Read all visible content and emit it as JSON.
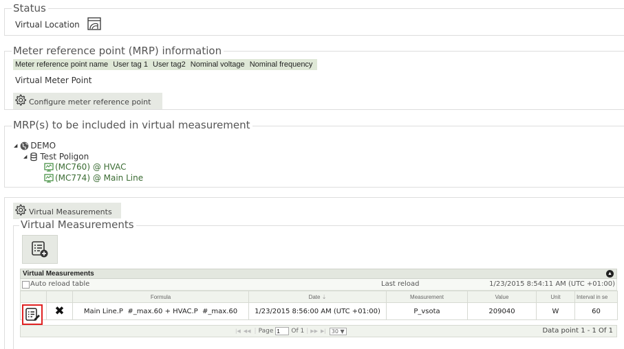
{
  "status": {
    "legend": "Status",
    "location_label": "Virtual Location"
  },
  "mrp": {
    "legend": "Meter reference point (MRP) information",
    "columns": [
      "Meter reference point name",
      "User tag 1",
      "User tag2",
      "Nominal voltage",
      "Nominal frequency"
    ],
    "value": "Virtual Meter Point",
    "configure_label": "Configure meter reference point"
  },
  "included": {
    "legend": "MRP(s) to be included in virtual measurement",
    "tree": {
      "root": "DEMO",
      "child": "Test Poligon",
      "leaves": [
        "(MC760) @ HVAC",
        "(MC774) @ Main Line"
      ]
    }
  },
  "vm": {
    "tab_label": "Virtual Measurements",
    "legend": "Virtual Measurements",
    "grid_title": "Virtual Measurements",
    "auto_reload_label": "Auto reload table",
    "last_reload_label": "Last reload",
    "last_reload_value": "1/23/2015 8:54:11 AM (UTC +01:00)",
    "columns": {
      "formula": "Formula",
      "date": "Date",
      "measurement": "Measurement",
      "value": "Value",
      "unit": "Unit",
      "interval": "Interval in se"
    },
    "rows": [
      {
        "formula": "Main Line.P  #_max.60 + HVAC.P  #_max.60",
        "date": "1/23/2015 8:56:00 AM (UTC +01:00)",
        "measurement": "P_vsota",
        "value": "209040",
        "unit": "W",
        "interval": "60"
      }
    ],
    "pager": {
      "page_label": "Page",
      "page_value": "1",
      "of_label": "Of 1",
      "page_size": "30",
      "summary": "Data point 1 - 1 Of 1"
    }
  }
}
